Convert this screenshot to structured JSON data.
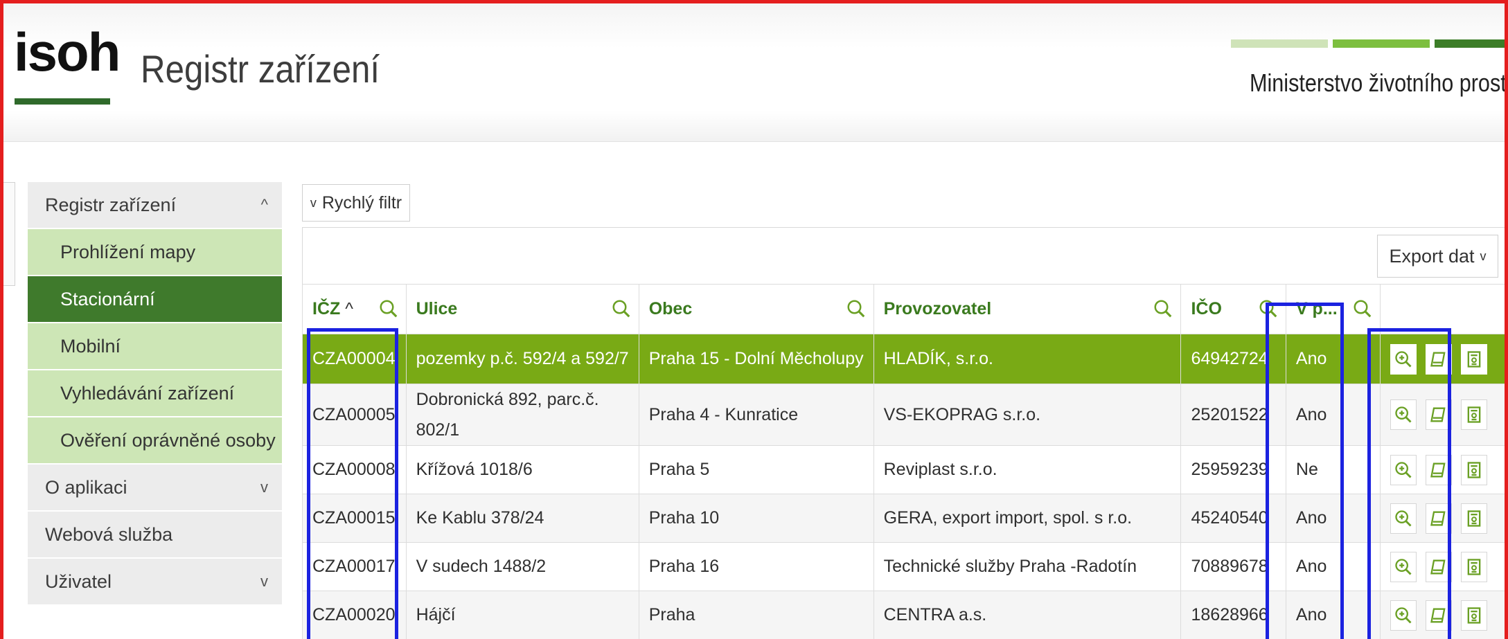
{
  "header": {
    "logo_text": "isoh",
    "app_title": "Registr zařízení",
    "ministry": "Ministerstvo životního prostřed",
    "stripe_colors": [
      "#cfe3b8",
      "#7dbf3f",
      "#3c7d28"
    ]
  },
  "sidebar": {
    "items": [
      {
        "label": "Registr zařízení",
        "kind": "top",
        "chevron": "^"
      },
      {
        "label": "Prohlížení mapy",
        "kind": "sub"
      },
      {
        "label": "Stacionární",
        "kind": "sub",
        "active": true
      },
      {
        "label": "Mobilní",
        "kind": "sub"
      },
      {
        "label": "Vyhledávání zařízení",
        "kind": "sub"
      },
      {
        "label": "Ověření oprávněné osoby",
        "kind": "sub"
      },
      {
        "label": "O aplikaci",
        "kind": "top",
        "chevron": "v"
      },
      {
        "label": "Webová služba",
        "kind": "top"
      },
      {
        "label": "Uživatel",
        "kind": "top",
        "chevron": "v"
      }
    ]
  },
  "toolbar": {
    "quick_filter": "Rychlý filtr",
    "quick_filter_chevron": "v",
    "export": "Export dat",
    "export_chevron": "v"
  },
  "table": {
    "columns": [
      {
        "label": "IČZ",
        "sort": "^"
      },
      {
        "label": "Ulice"
      },
      {
        "label": "Obec"
      },
      {
        "label": "Provozovatel"
      },
      {
        "label": "IČO"
      },
      {
        "label": "V p..."
      },
      {
        "label": ""
      }
    ],
    "rows": [
      {
        "icz": "CZA00004",
        "ulice": "pozemky p.č. 592/4 a 592/7",
        "obec": "Praha 15 - Dolní Měcholupy",
        "provozovatel": "HLADÍK, s.r.o.",
        "ico": "64942724",
        "vp": "Ano",
        "selected": true
      },
      {
        "icz": "CZA00005",
        "ulice": "Dobronická 892, parc.č. 802/1",
        "obec": "Praha 4 - Kunratice",
        "provozovatel": "VS-EKOPRAG s.r.o.",
        "ico": "25201522",
        "vp": "Ano"
      },
      {
        "icz": "CZA00008",
        "ulice": "Křížová 1018/6",
        "obec": "Praha 5",
        "provozovatel": "Reviplast s.r.o.",
        "ico": "25959239",
        "vp": "Ne"
      },
      {
        "icz": "CZA00015",
        "ulice": "Ke Kablu 378/24",
        "obec": "Praha 10",
        "provozovatel": "GERA, export import, spol. s r.o.",
        "ico": "45240540",
        "vp": "Ano"
      },
      {
        "icz": "CZA00017",
        "ulice": "V sudech 1488/2",
        "obec": "Praha 16",
        "provozovatel": "Technické služby Praha -Radotín",
        "ico": "70889678",
        "vp": "Ano"
      },
      {
        "icz": "CZA00020",
        "ulice": "Hájčí",
        "obec": "Praha",
        "provozovatel": "CENTRA a.s.",
        "ico": "18628966",
        "vp": "Ano"
      }
    ],
    "row_actions": [
      "zoom-in-icon",
      "book-icon",
      "document-icon"
    ]
  },
  "colors": {
    "frame_red": "#e41e1e",
    "highlight_blue": "#1b22e0",
    "selected_row": "#79aa15",
    "active_nav": "#3f7a2c",
    "sub_nav": "#cde6b6",
    "header_green": "#3a7a1e"
  }
}
